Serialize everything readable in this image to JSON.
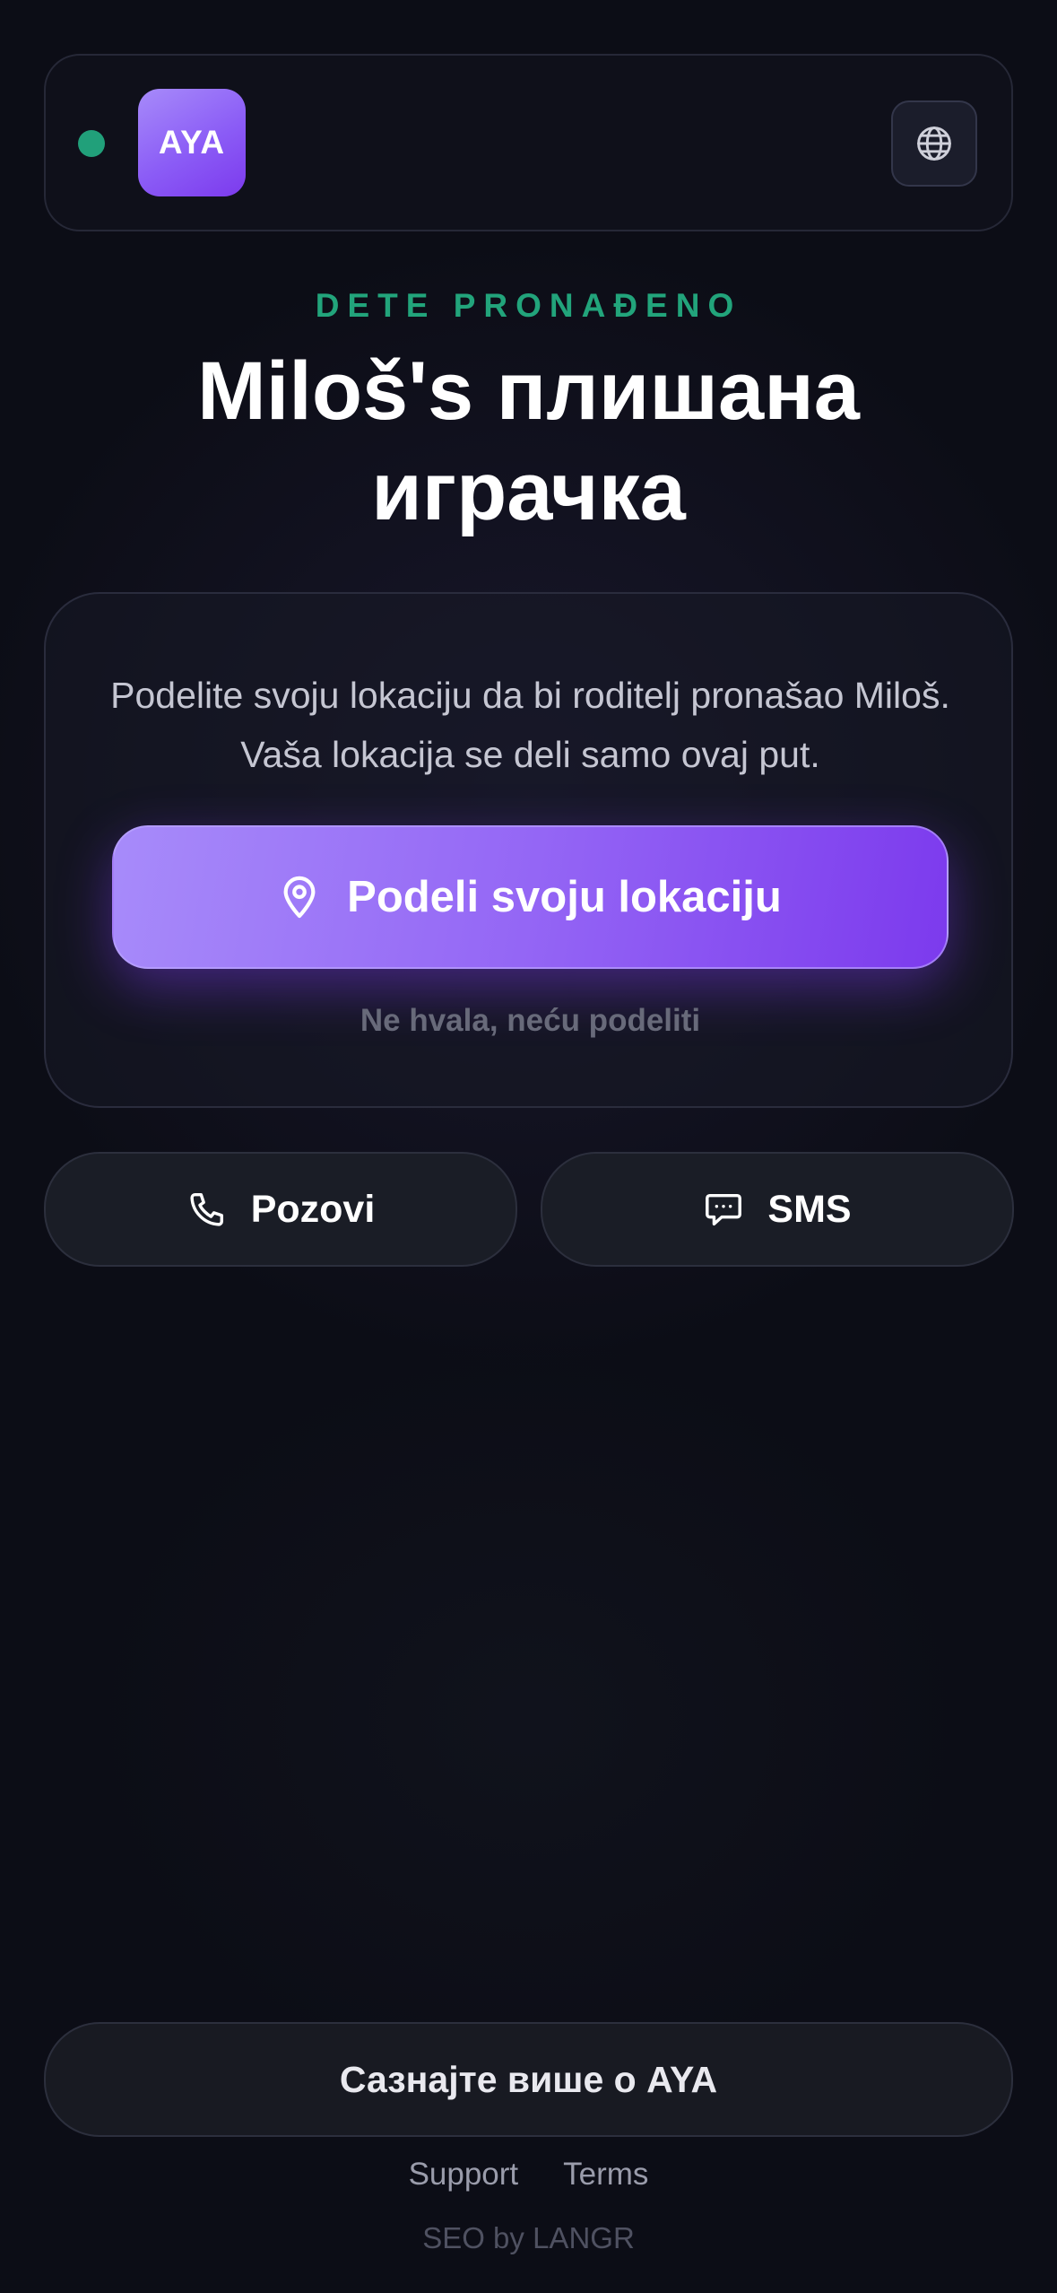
{
  "header": {
    "logo_text": "AYA",
    "status_color": "#21a07a",
    "language_icon": "globe-icon"
  },
  "hero": {
    "eyebrow": "DETE PRONAĐENO",
    "title": "Miloš's плишана играчка"
  },
  "share_card": {
    "description": "Podelite svoju lokaciju da bi roditelj pronašao Miloš. Vaša lokacija se deli samo ovaj put.",
    "share_button_label": "Podeli svoju lokaciju",
    "share_icon": "map-pin-icon",
    "decline_label": "Ne hvala, neću podeliti"
  },
  "contact": {
    "call_label": "Pozovi",
    "call_icon": "phone-icon",
    "sms_label": "SMS",
    "sms_icon": "chat-bubble-icon"
  },
  "footer": {
    "learn_more_label": "Сазнајте више о AYA",
    "links": [
      "Support",
      "Terms"
    ],
    "credit": "SEO by LANGR"
  },
  "colors": {
    "accent": "#8b5cf6",
    "success": "#22a47b",
    "background": "#0c0d16"
  }
}
